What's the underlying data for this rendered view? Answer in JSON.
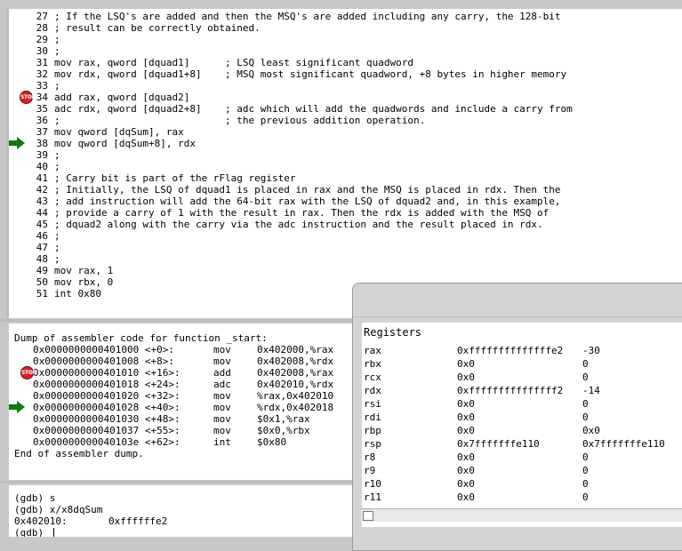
{
  "source": {
    "lines": [
      {
        "n": "27",
        "text": "; If the LSQ's are added and then the MSQ's are added including any carry, the 128-bit"
      },
      {
        "n": "28",
        "text": "; result can be correctly obtained."
      },
      {
        "n": "29",
        "text": ";"
      },
      {
        "n": "30",
        "text": ";"
      },
      {
        "n": "31",
        "text": "mov rax, qword [dquad1]      ; LSQ least significant quadword"
      },
      {
        "n": "32",
        "text": "mov rdx, qword [dquad1+8]    ; MSQ most significant quadword, +8 bytes in higher memory"
      },
      {
        "n": "33",
        "text": ";"
      },
      {
        "n": "34",
        "text": "add rax, qword [dquad2]",
        "marker": "stop"
      },
      {
        "n": "35",
        "text": "adc rdx, qword [dquad2+8]    ; adc which will add the quadwords and include a carry from"
      },
      {
        "n": "36",
        "text": ";                            ; the previous addition operation."
      },
      {
        "n": "37",
        "text": "mov qword [dqSum], rax"
      },
      {
        "n": "38",
        "text": "mov qword [dqSum+8], rdx",
        "marker": "arrow"
      },
      {
        "n": "39",
        "text": ";"
      },
      {
        "n": "40",
        "text": ";"
      },
      {
        "n": "41",
        "text": "; Carry bit is part of the rFlag register"
      },
      {
        "n": "42",
        "text": "; Initially, the LSQ of dquad1 is placed in rax and the MSQ is placed in rdx. Then the"
      },
      {
        "n": "43",
        "text": "; add instruction will add the 64-bit rax with the LSQ of dquad2 and, in this example,"
      },
      {
        "n": "44",
        "text": "; provide a carry of 1 with the result in rax. Then the rdx is added with the MSQ of"
      },
      {
        "n": "45",
        "text": "; dquad2 along with the carry via the adc instruction and the result placed in rdx."
      },
      {
        "n": "46",
        "text": ";"
      },
      {
        "n": "47",
        "text": ";"
      },
      {
        "n": "48",
        "text": ";"
      },
      {
        "n": "49",
        "text": "mov rax, 1"
      },
      {
        "n": "50",
        "text": "mov rbx, 0"
      },
      {
        "n": "51",
        "text": "int 0x80"
      }
    ]
  },
  "disasm": {
    "header": "Dump of assembler code for function _start:",
    "rows": [
      {
        "addr": "0x0000000000401000 <+0>:",
        "op": "mov",
        "args": "0x402000,%rax"
      },
      {
        "addr": "0x0000000000401008 <+8>:",
        "op": "mov",
        "args": "0x402008,%rdx"
      },
      {
        "addr": "0x0000000000401010 <+16>:",
        "op": "add",
        "args": "0x402008,%rax",
        "marker": "stop"
      },
      {
        "addr": "0x0000000000401018 <+24>:",
        "op": "adc",
        "args": "0x402010,%rdx"
      },
      {
        "addr": "0x0000000000401020 <+32>:",
        "op": "mov",
        "args": "%rax,0x402010"
      },
      {
        "addr": "0x0000000000401028 <+40>:",
        "op": "mov",
        "args": "%rdx,0x402018",
        "marker": "arrow"
      },
      {
        "addr": "0x0000000000401030 <+48>:",
        "op": "mov",
        "args": "$0x1,%rax"
      },
      {
        "addr": "0x0000000000401037 <+55>:",
        "op": "mov",
        "args": "$0x0,%rbx"
      },
      {
        "addr": "0x000000000040103e <+62>:",
        "op": "int",
        "args": "$0x80"
      }
    ],
    "footer": "End of assembler dump."
  },
  "console": {
    "lines": [
      "(gdb) s",
      "(gdb) x/x8dqSum",
      "0x402010:       0xffffffe2",
      "(gdb) "
    ]
  },
  "registers": {
    "title": "Registers",
    "rows": [
      {
        "name": "rax",
        "hex": "0xffffffffffffffe2",
        "val": "-30"
      },
      {
        "name": "rbx",
        "hex": "0x0",
        "val": "0"
      },
      {
        "name": "rcx",
        "hex": "0x0",
        "val": "0"
      },
      {
        "name": "rdx",
        "hex": "0xfffffffffffffff2",
        "val": "-14"
      },
      {
        "name": "rsi",
        "hex": "0x0",
        "val": "0"
      },
      {
        "name": "rdi",
        "hex": "0x0",
        "val": "0"
      },
      {
        "name": "rbp",
        "hex": "0x0",
        "val": "0x0"
      },
      {
        "name": "rsp",
        "hex": "0x7fffffffe110",
        "val": "0x7fffffffe110"
      },
      {
        "name": "r8",
        "hex": "0x0",
        "val": "0"
      },
      {
        "name": "r9",
        "hex": "0x0",
        "val": "0"
      },
      {
        "name": "r10",
        "hex": "0x0",
        "val": "0"
      },
      {
        "name": "r11",
        "hex": "0x0",
        "val": "0"
      }
    ]
  },
  "icons": {
    "breakpoint": "stop-sign-icon",
    "current_line": "green-arrow-icon"
  },
  "colors": {
    "breakpoint": "#d42020",
    "arrow": "#0d7a0d"
  },
  "stop_label": "STOP"
}
